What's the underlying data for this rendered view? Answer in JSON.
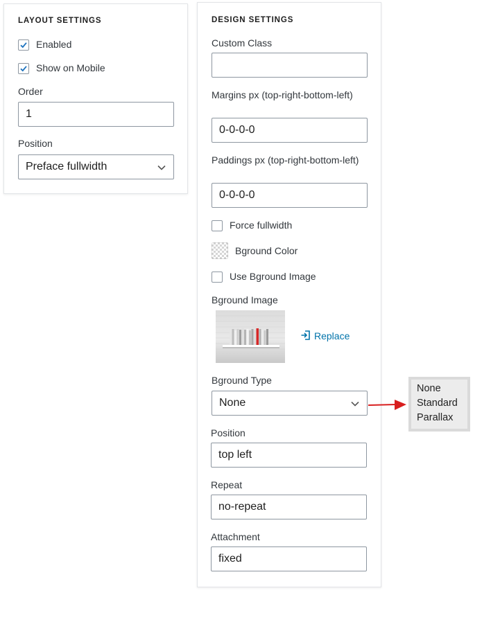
{
  "layout_settings": {
    "heading": "LAYOUT SETTINGS",
    "enabled_label": "Enabled",
    "enabled_checked": true,
    "show_mobile_label": "Show on Mobile",
    "show_mobile_checked": true,
    "order_label": "Order",
    "order_value": "1",
    "position_label": "Position",
    "position_value": "Preface fullwidth"
  },
  "design_settings": {
    "heading": "DESIGN SETTINGS",
    "custom_class_label": "Custom Class",
    "custom_class_value": "",
    "margins_label": "Margins px (top-right-bottom-left)",
    "margins_value": "0-0-0-0",
    "paddings_label": "Paddings px (top-right-bottom-left)",
    "paddings_value": "0-0-0-0",
    "force_fullwidth_label": "Force fullwidth",
    "force_fullwidth_checked": false,
    "bground_color_label": "Bground Color",
    "use_bground_image_label": "Use Bground Image",
    "use_bground_image_checked": false,
    "bground_image_label": "Bground Image",
    "replace_label": "Replace",
    "bground_type_label": "Bground Type",
    "bground_type_value": "None",
    "position_label": "Position",
    "position_value": "top left",
    "repeat_label": "Repeat",
    "repeat_value": "no-repeat",
    "attachment_label": "Attachment",
    "attachment_value": "fixed"
  },
  "bground_type_options": [
    "None",
    "Standard",
    "Parallax"
  ],
  "colors": {
    "accent": "#0073aa",
    "checkmark": "#1e73be",
    "arrow": "#d81e1e"
  },
  "icons": {
    "checkbox_checked": "checkmark-icon",
    "select_chevron": "chevron-down-icon",
    "replace": "replace-icon",
    "pointer": "red-arrow-icon"
  }
}
